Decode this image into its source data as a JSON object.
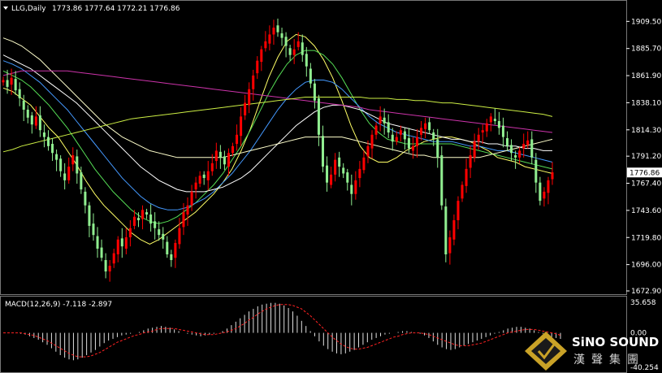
{
  "header": {
    "symbol_label": "LLG,Daily",
    "ohlc": "1773.86 1777.64 1772.21 1776.86"
  },
  "macd_header": "MACD(12,26,9) -7.118 -2.897",
  "brand": {
    "name": "SiNO SOUND",
    "chinese": "漢聲集團"
  },
  "colors": {
    "background": "#000000",
    "bull": "#ff0000",
    "bear": "#90ee90",
    "axis": "#ffffff",
    "current_price_box": "#ffffff"
  },
  "chart_data": [
    {
      "type": "candlestick",
      "title": "LLG,Daily",
      "current_price": 1776.86,
      "ylim": [
        1672.9,
        1924.0
      ],
      "y_ticks": [
        "1909.50",
        "1885.70",
        "1861.90",
        "1838.10",
        "1814.30",
        "1791.20",
        "1767.40",
        "1743.60",
        "1719.80",
        "1696.00",
        "1672.90"
      ],
      "y_tick_values": [
        1909.5,
        1885.7,
        1861.9,
        1838.1,
        1814.3,
        1791.2,
        1767.4,
        1743.6,
        1719.8,
        1696.0,
        1672.9
      ],
      "closes": [
        1858,
        1852,
        1860,
        1849,
        1842,
        1832,
        1825,
        1819,
        1826,
        1814,
        1808,
        1800,
        1794,
        1788,
        1778,
        1770,
        1782,
        1792,
        1776,
        1762,
        1748,
        1730,
        1722,
        1710,
        1702,
        1690,
        1695,
        1706,
        1718,
        1712,
        1720,
        1728,
        1738,
        1735,
        1744,
        1740,
        1732,
        1728,
        1722,
        1718,
        1705,
        1700,
        1715,
        1728,
        1742,
        1748,
        1760,
        1768,
        1774,
        1772,
        1778,
        1785,
        1796,
        1790,
        1784,
        1794,
        1800,
        1810,
        1826,
        1838,
        1850,
        1862,
        1875,
        1885,
        1892,
        1898,
        1904,
        1900,
        1895,
        1888,
        1880,
        1885,
        1892,
        1880,
        1870,
        1855,
        1840,
        1810,
        1782,
        1768,
        1775,
        1788,
        1782,
        1776,
        1768,
        1758,
        1770,
        1780,
        1790,
        1800,
        1810,
        1818,
        1826,
        1820,
        1812,
        1804,
        1808,
        1814,
        1806,
        1798,
        1800,
        1808,
        1816,
        1820,
        1814,
        1806,
        1790,
        1748,
        1705,
        1720,
        1735,
        1752,
        1766,
        1780,
        1792,
        1804,
        1810,
        1814,
        1820,
        1826,
        1822,
        1816,
        1808,
        1800,
        1794,
        1790,
        1796,
        1802,
        1805,
        1790,
        1768,
        1752,
        1760,
        1770,
        1777
      ],
      "series": [
        {
          "name": "",
          "values": [
            1851,
            1848,
            1842,
            1836,
            1826,
            1816,
            1808,
            1796,
            1784,
            1770,
            1758,
            1748,
            1740,
            1732,
            1724,
            1718,
            1714,
            1718,
            1724,
            1730,
            1736,
            1742,
            1750,
            1758,
            1768,
            1780,
            1796,
            1815,
            1838,
            1860,
            1878,
            1892,
            1898,
            1896,
            1888,
            1876,
            1860,
            1840,
            1818,
            1800,
            1790,
            1786,
            1786,
            1790,
            1796,
            1800,
            1804,
            1806,
            1808,
            1808,
            1806,
            1804,
            1800,
            1796,
            1790,
            1788,
            1786,
            1782,
            1780,
            1778,
            1776
          ]
        },
        {
          "name": "",
          "values": [
            1866,
            1862,
            1858,
            1852,
            1844,
            1836,
            1826,
            1816,
            1804,
            1792,
            1780,
            1770,
            1760,
            1752,
            1744,
            1738,
            1734,
            1732,
            1734,
            1738,
            1744,
            1750,
            1758,
            1766,
            1776,
            1788,
            1800,
            1814,
            1830,
            1846,
            1860,
            1872,
            1880,
            1884,
            1884,
            1880,
            1872,
            1860,
            1846,
            1832,
            1820,
            1812,
            1806,
            1804,
            1802,
            1802,
            1802,
            1802,
            1802,
            1802,
            1800,
            1798,
            1796,
            1794,
            1792,
            1790,
            1788,
            1786,
            1784,
            1782,
            1780
          ]
        },
        {
          "name": "",
          "values": [
            1875,
            1872,
            1868,
            1862,
            1856,
            1848,
            1840,
            1832,
            1822,
            1812,
            1802,
            1792,
            1782,
            1772,
            1764,
            1756,
            1750,
            1746,
            1744,
            1744,
            1746,
            1750,
            1754,
            1760,
            1768,
            1776,
            1786,
            1796,
            1808,
            1820,
            1832,
            1842,
            1850,
            1856,
            1858,
            1858,
            1856,
            1850,
            1842,
            1834,
            1826,
            1820,
            1816,
            1812,
            1810,
            1808,
            1806,
            1804,
            1804,
            1804,
            1802,
            1800,
            1800,
            1798,
            1796,
            1796,
            1794,
            1792,
            1790,
            1788,
            1786
          ]
        },
        {
          "name": "",
          "values": [
            1880,
            1876,
            1872,
            1868,
            1862,
            1856,
            1850,
            1844,
            1838,
            1830,
            1822,
            1814,
            1806,
            1798,
            1790,
            1782,
            1776,
            1770,
            1766,
            1762,
            1760,
            1760,
            1760,
            1762,
            1764,
            1768,
            1772,
            1778,
            1786,
            1794,
            1802,
            1810,
            1818,
            1824,
            1830,
            1834,
            1836,
            1836,
            1834,
            1832,
            1828,
            1824,
            1820,
            1818,
            1816,
            1814,
            1812,
            1810,
            1808,
            1806,
            1806,
            1804,
            1804,
            1802,
            1802,
            1800,
            1800,
            1798,
            1798,
            1796,
            1796
          ]
        },
        {
          "name": "",
          "values": [
            1895,
            1892,
            1888,
            1882,
            1876,
            1868,
            1860,
            1852,
            1844,
            1836,
            1828,
            1820,
            1814,
            1808,
            1804,
            1800,
            1796,
            1794,
            1792,
            1790,
            1790,
            1790,
            1790,
            1790,
            1790,
            1792,
            1794,
            1796,
            1798,
            1800,
            1802,
            1804,
            1806,
            1808,
            1808,
            1808,
            1808,
            1808,
            1806,
            1804,
            1802,
            1800,
            1798,
            1796,
            1794,
            1792,
            1792,
            1790,
            1790,
            1790,
            1790,
            1790,
            1790,
            1792,
            1794,
            1796,
            1798,
            1800,
            1802,
            1804,
            1806
          ]
        },
        {
          "name": "",
          "values": [
            1862,
            1864,
            1866,
            1866,
            1866,
            1866,
            1866,
            1866,
            1865,
            1864,
            1863,
            1862,
            1861,
            1860,
            1859,
            1858,
            1857,
            1856,
            1855,
            1854,
            1853,
            1852,
            1851,
            1850,
            1849,
            1848,
            1847,
            1846,
            1845,
            1844,
            1843,
            1842,
            1841,
            1840,
            1839,
            1838,
            1837,
            1836,
            1835,
            1834,
            1832,
            1831,
            1830,
            1829,
            1828,
            1827,
            1826,
            1825,
            1824,
            1823,
            1822,
            1821,
            1820,
            1819,
            1818,
            1817,
            1816,
            1815,
            1814,
            1813,
            1812
          ]
        },
        {
          "name": "",
          "values": [
            1795,
            1797,
            1800,
            1802,
            1804,
            1806,
            1808,
            1810,
            1812,
            1814,
            1816,
            1818,
            1820,
            1822,
            1824,
            1825,
            1826,
            1827,
            1828,
            1829,
            1830,
            1831,
            1832,
            1833,
            1834,
            1835,
            1836,
            1837,
            1838,
            1839,
            1840,
            1841,
            1842,
            1843,
            1843,
            1843,
            1843,
            1843,
            1843,
            1843,
            1842,
            1842,
            1842,
            1841,
            1841,
            1840,
            1840,
            1839,
            1838,
            1838,
            1837,
            1836,
            1835,
            1834,
            1833,
            1832,
            1831,
            1830,
            1829,
            1828,
            1826
          ]
        }
      ]
    },
    {
      "type": "bar",
      "title": "MACD(12,26,9)",
      "macd": -7.118,
      "signal": -2.897,
      "ylim": [
        -40.254,
        35.658
      ],
      "y_ticks": [
        "35.658",
        "0.00",
        "-40.254"
      ],
      "y_tick_values": [
        35.658,
        0.0,
        -40.254
      ],
      "histogram": [
        0,
        0,
        0,
        0,
        -1,
        -2,
        -4,
        -6,
        -8,
        -11,
        -14,
        -18,
        -22,
        -26,
        -29,
        -31,
        -32,
        -31,
        -29,
        -26,
        -23,
        -20,
        -16,
        -12,
        -9,
        -7,
        -5,
        -3,
        -2,
        -1,
        0,
        1,
        3,
        5,
        6,
        7,
        8,
        7,
        6,
        4,
        2,
        0,
        -1,
        -2,
        -3,
        -4,
        -3,
        -2,
        -1,
        0,
        2,
        5,
        9,
        13,
        17,
        21,
        25,
        28,
        31,
        33,
        34,
        35,
        35,
        34,
        32,
        29,
        25,
        20,
        14,
        8,
        2,
        -4,
        -10,
        -15,
        -19,
        -22,
        -24,
        -25,
        -24,
        -22,
        -20,
        -17,
        -14,
        -11,
        -8,
        -6,
        -4,
        -2,
        -1,
        0,
        1,
        2,
        2,
        1,
        0,
        -1,
        -3,
        -6,
        -10,
        -14,
        -17,
        -19,
        -20,
        -19,
        -17,
        -15,
        -13,
        -11,
        -9,
        -7,
        -5,
        -3,
        -1,
        1,
        3,
        5,
        6,
        7,
        7,
        6,
        5,
        3,
        1,
        -1,
        -3,
        -5,
        -6,
        -7
      ],
      "signal_line": [
        0,
        0,
        0,
        0,
        0,
        -1,
        -2,
        -3,
        -5,
        -7,
        -9,
        -12,
        -15,
        -18,
        -21,
        -24,
        -26,
        -28,
        -28,
        -28,
        -27,
        -25,
        -23,
        -20,
        -17,
        -14,
        -11,
        -9,
        -7,
        -5,
        -3,
        -2,
        0,
        1,
        2,
        4,
        5,
        5,
        5,
        5,
        4,
        3,
        2,
        1,
        0,
        -1,
        -2,
        -2,
        -2,
        -1,
        0,
        1,
        3,
        5,
        8,
        11,
        15,
        18,
        22,
        25,
        28,
        30,
        32,
        33,
        33,
        33,
        32,
        30,
        28,
        24,
        20,
        15,
        10,
        5,
        0,
        -5,
        -9,
        -13,
        -16,
        -18,
        -19,
        -19,
        -18,
        -17,
        -15,
        -13,
        -11,
        -9,
        -7,
        -5,
        -4,
        -2,
        -1,
        0,
        0,
        0,
        -1,
        -2,
        -4,
        -6,
        -8,
        -10,
        -12,
        -14,
        -15,
        -15,
        -15,
        -14,
        -13,
        -12,
        -10,
        -8,
        -6,
        -4,
        -2,
        0,
        1,
        2,
        3,
        4,
        4,
        4,
        3,
        2,
        1,
        0,
        -1,
        -3
      ]
    }
  ]
}
